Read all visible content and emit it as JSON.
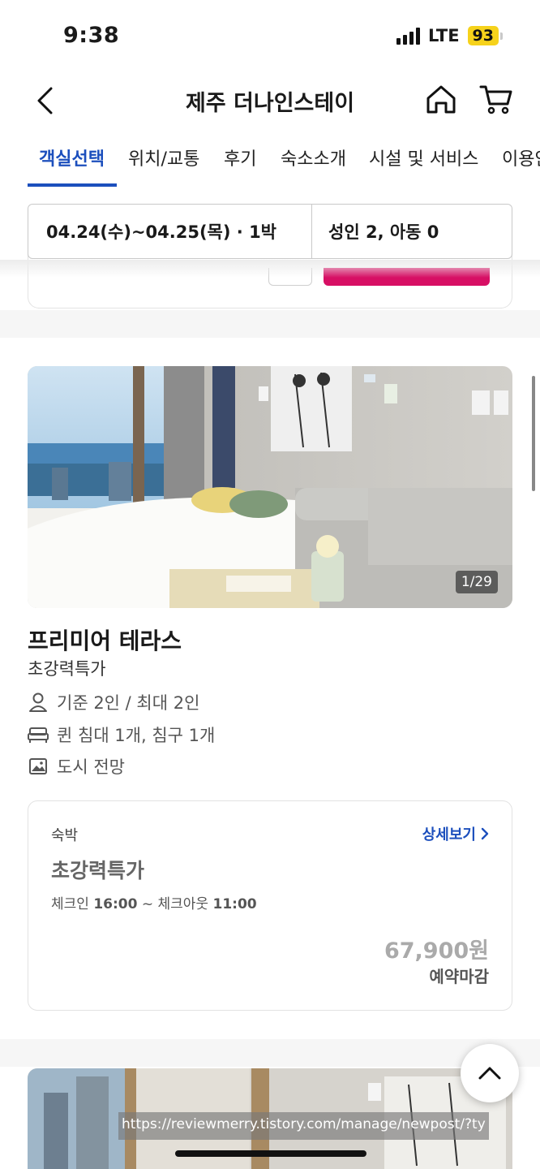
{
  "status_bar": {
    "time": "9:38",
    "network": "LTE",
    "battery": "93"
  },
  "header": {
    "title": "제주 더나인스테이",
    "icons": [
      "chevron-left-icon",
      "home-icon",
      "cart-icon"
    ]
  },
  "tabs": [
    {
      "label": "객실선택",
      "active": true
    },
    {
      "label": "위치/교통",
      "active": false
    },
    {
      "label": "후기",
      "active": false
    },
    {
      "label": "숙소소개",
      "active": false
    },
    {
      "label": "시설 및 서비스",
      "active": false
    },
    {
      "label": "이용안",
      "active": false
    }
  ],
  "search": {
    "dates": "04.24(수)~04.25(목) · 1박",
    "guests": "성인 2, 아동 0"
  },
  "room": {
    "photo_counter": "1/29",
    "name": "프리미어 테라스",
    "subtitle": "초강력특가",
    "features": [
      {
        "icon": "person-icon",
        "text": "기준 2인 / 최대 2인"
      },
      {
        "icon": "bed-icon",
        "text": "퀸 침대 1개, 침구 1개"
      },
      {
        "icon": "image-icon",
        "text": "도시 전망"
      }
    ],
    "rate": {
      "type": "숙박",
      "detail_link": "상세보기",
      "name": "초강력특가",
      "checkin_label": "체크인",
      "checkin_time": "16:00",
      "separator": "~",
      "checkout_label": "체크아웃",
      "checkout_time": "11:00",
      "price": "67,900원",
      "status": "예약마감"
    }
  },
  "overlay": {
    "url": "https://reviewmerry.tistory.com/manage/newpost/?ty"
  },
  "colors": {
    "accent": "#1c4fbd",
    "brand_red": "#d70f64",
    "price_muted": "#aaaaaa"
  }
}
